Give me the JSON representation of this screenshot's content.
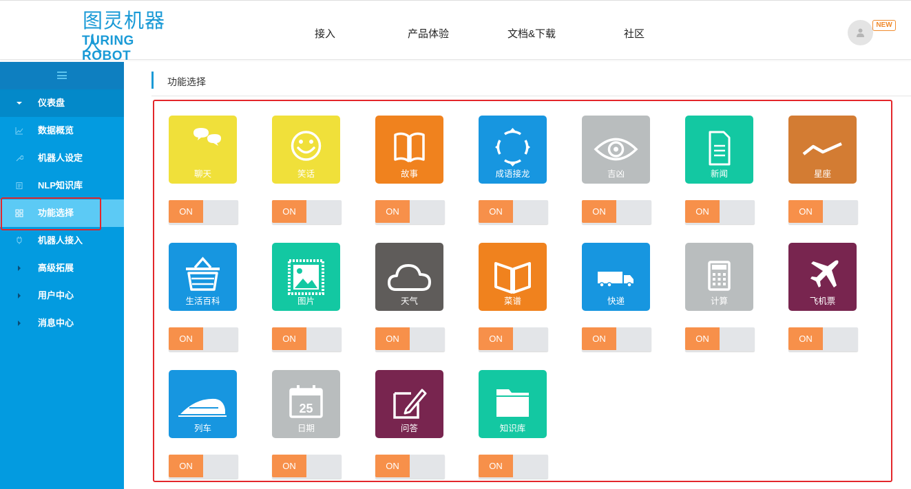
{
  "brand": {
    "logo_cn": "图灵机器人",
    "logo_en": "TURING ROBOT"
  },
  "topnav": [
    "接入",
    "产品体验",
    "文档&下载",
    "社区"
  ],
  "user": {
    "badge": "NEW"
  },
  "sidebar": {
    "group": "仪表盘",
    "items": [
      "数据概览",
      "机器人设定",
      "NLP知识库",
      "功能选择",
      "机器人接入"
    ],
    "active": "功能选择",
    "collapsed": [
      "高级拓展",
      "用户中心",
      "消息中心"
    ]
  },
  "main": {
    "title": "功能选择"
  },
  "toggle_label": "ON",
  "features": [
    {
      "label": "聊天",
      "icon": "chat-icon",
      "color": "#f0e03a",
      "enabled": true
    },
    {
      "label": "笑话",
      "icon": "smiley-icon",
      "color": "#f0e03a",
      "enabled": true
    },
    {
      "label": "故事",
      "icon": "book-icon",
      "color": "#f0821e",
      "enabled": true
    },
    {
      "label": "成语接龙",
      "icon": "idiom-circle-icon",
      "color": "#1796e0",
      "enabled": true
    },
    {
      "label": "吉凶",
      "icon": "eye-icon",
      "color": "#b9bdbe",
      "enabled": true
    },
    {
      "label": "新闻",
      "icon": "document-icon",
      "color": "#13c8a2",
      "enabled": true
    },
    {
      "label": "星座",
      "icon": "zigzag-icon",
      "color": "#d37c33",
      "enabled": true
    },
    {
      "label": "生活百科",
      "icon": "basket-icon",
      "color": "#1796e0",
      "enabled": true
    },
    {
      "label": "图片",
      "icon": "picture-icon",
      "color": "#13c8a2",
      "enabled": true
    },
    {
      "label": "天气",
      "icon": "cloud-icon",
      "color": "#5f5c5a",
      "enabled": true
    },
    {
      "label": "菜谱",
      "icon": "open-book-icon",
      "color": "#f0821e",
      "enabled": true
    },
    {
      "label": "快递",
      "icon": "truck-icon",
      "color": "#1796e0",
      "enabled": true
    },
    {
      "label": "计算",
      "icon": "calculator-icon",
      "color": "#b9bdbe",
      "enabled": true
    },
    {
      "label": "飞机票",
      "icon": "airplane-icon",
      "color": "#78254f",
      "enabled": true
    },
    {
      "label": "列车",
      "icon": "train-icon",
      "color": "#1796e0",
      "enabled": true
    },
    {
      "label": "日期",
      "icon": "calendar-icon",
      "color": "#b9bdbe",
      "calendar_day": "25",
      "enabled": true
    },
    {
      "label": "问答",
      "icon": "edit-icon",
      "color": "#78254f",
      "enabled": true
    },
    {
      "label": "知识库",
      "icon": "folder-icon",
      "color": "#13c8a2",
      "enabled": true
    }
  ]
}
